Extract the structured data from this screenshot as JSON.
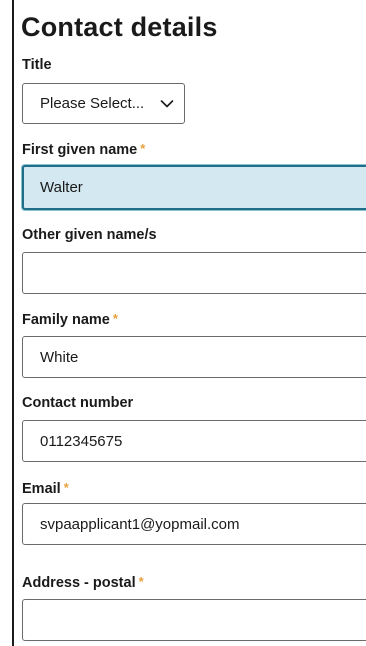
{
  "form": {
    "title": "Contact details",
    "required_marker": "*",
    "title_field": {
      "label": "Title",
      "selected": "Please Select..."
    },
    "first_given_name": {
      "label": "First given name",
      "value": "Walter"
    },
    "other_given_names": {
      "label": "Other given name/s",
      "value": ""
    },
    "family_name": {
      "label": "Family name",
      "value": "White"
    },
    "contact_number": {
      "label": "Contact number",
      "value": "0112345675"
    },
    "email": {
      "label": "Email",
      "value": "svpaapplicant1@yopmail.com"
    },
    "address_postal": {
      "label": "Address - postal",
      "value": ""
    }
  },
  "colors": {
    "required_marker": "#e8a13a",
    "focus_border": "#1f6f8b",
    "focus_background": "#d3e8f1"
  },
  "icons": {
    "select_arrow": "chevron-down-icon"
  }
}
